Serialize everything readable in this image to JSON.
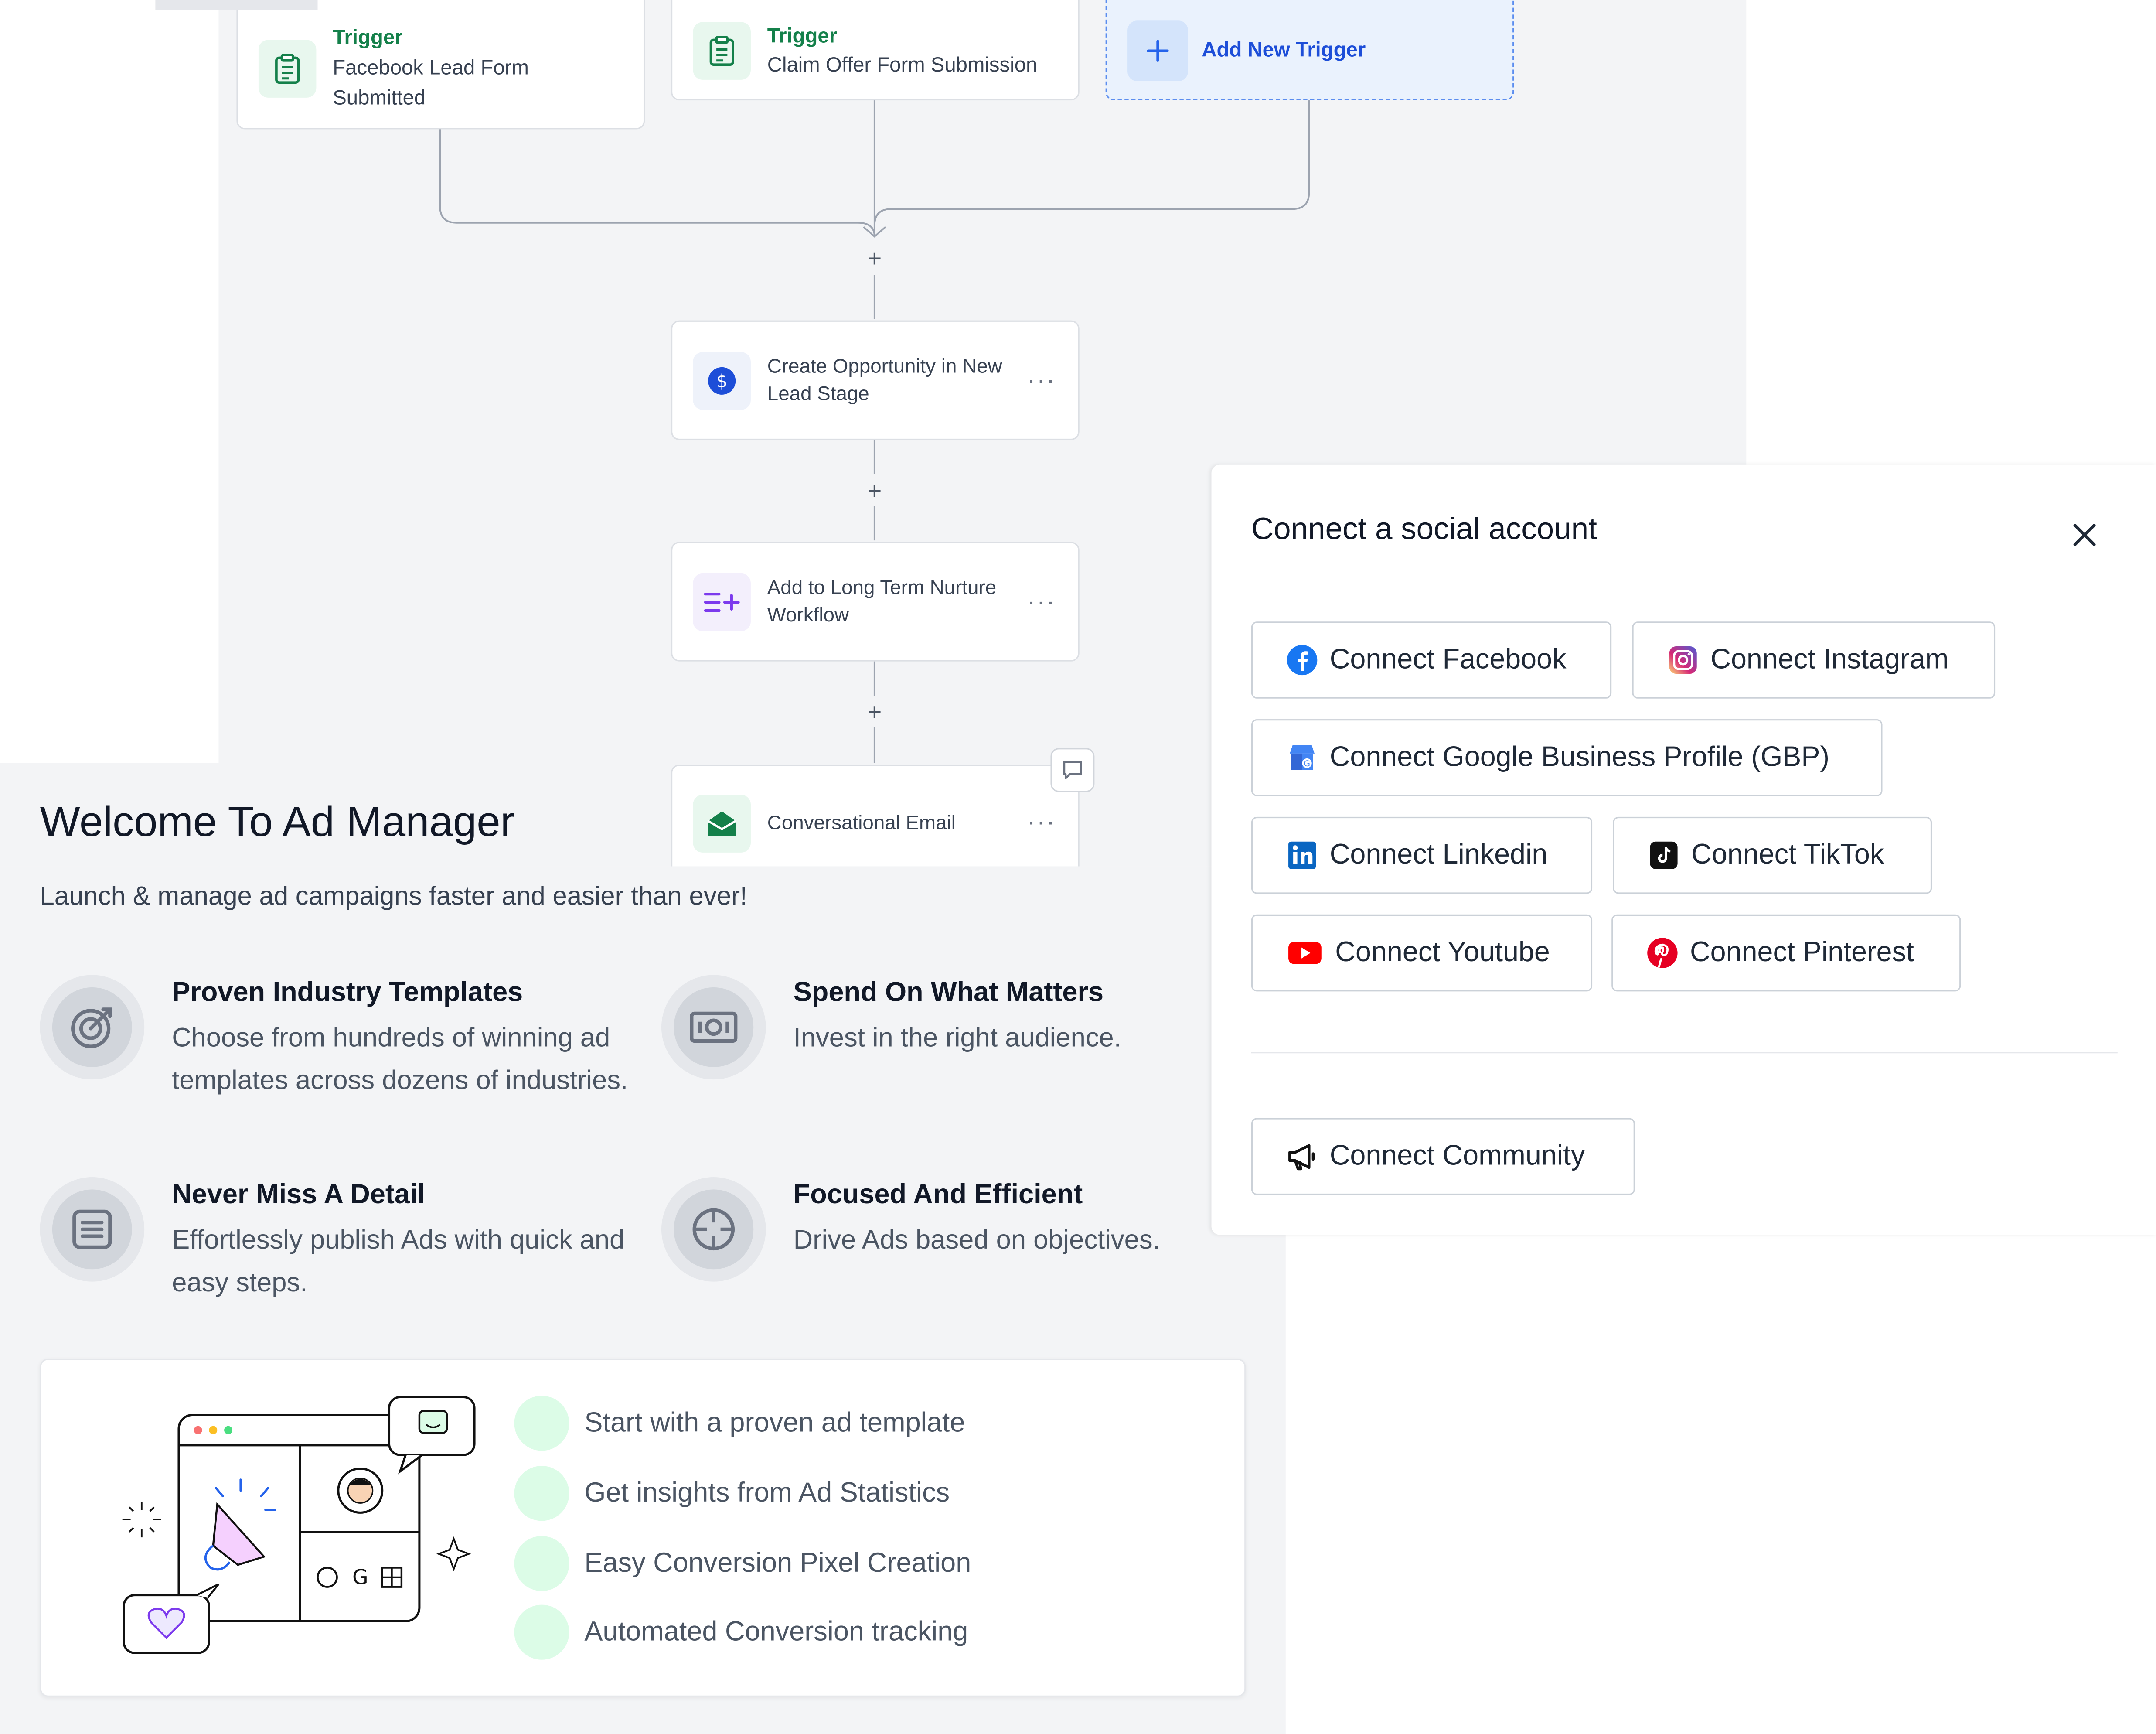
{
  "workflow": {
    "triggers": [
      {
        "tag": "Trigger",
        "name": "Facebook Lead Form Submitted"
      },
      {
        "tag": "Trigger",
        "name": "Claim Offer Form Submission"
      }
    ],
    "add_trigger_label": "Add New Trigger",
    "actions": [
      {
        "name": "Create Opportunity in New Lead Stage",
        "icon": "dollar-icon"
      },
      {
        "name": "Add to Long Term Nurture Workflow",
        "icon": "list-add-icon"
      },
      {
        "name": "Conversational Email",
        "icon": "envelope-icon"
      }
    ],
    "add_step_symbol": "+",
    "menu_symbol": "···"
  },
  "welcome": {
    "title": "Welcome To Ad Manager",
    "subtitle": "Launch & manage ad campaigns faster and easier than ever!",
    "features": [
      {
        "title": "Proven Industry Templates",
        "description": "Choose from hundreds of winning ad templates across dozens of industries.",
        "icon": "target-icon"
      },
      {
        "title": "Spend On What Matters",
        "description": "Invest in the right audience.",
        "icon": "money-icon"
      },
      {
        "title": "Never Miss A Detail",
        "description": "Effortlessly publish Ads with quick and easy steps.",
        "icon": "document-list-icon"
      },
      {
        "title": "Focused And Efficient",
        "description": "Drive Ads based on objectives.",
        "icon": "crosshair-icon"
      }
    ],
    "checklist": [
      "Start with a proven ad template",
      "Get insights from Ad Statistics",
      "Easy Conversion Pixel Creation",
      "Automated Conversion tracking"
    ]
  },
  "social_modal": {
    "title": "Connect a social account",
    "buttons": {
      "facebook": "Connect Facebook",
      "instagram": "Connect Instagram",
      "gbp": "Connect Google Business Profile (GBP)",
      "linkedin": "Connect Linkedin",
      "tiktok": "Connect TikTok",
      "youtube": "Connect Youtube",
      "pinterest": "Connect Pinterest",
      "community": "Connect Community"
    }
  },
  "colors": {
    "trigger_green": "#14804a",
    "accent_blue": "#1d4ed8",
    "canvas_gray": "#f3f4f6",
    "check_green": "#dcfce7"
  }
}
